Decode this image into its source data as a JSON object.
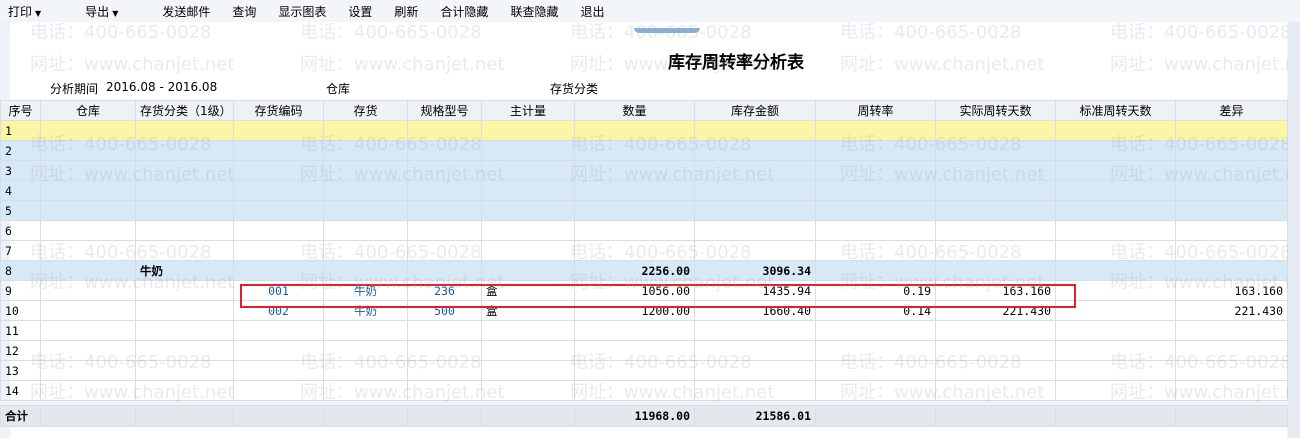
{
  "toolbar": {
    "items": [
      "打印",
      "导出",
      "发送邮件",
      "查询",
      "显示图表",
      "设置",
      "刷新",
      "合计隐藏",
      "联查隐藏",
      "退出"
    ]
  },
  "title": "库存周转率分析表",
  "filters": {
    "period_label": "分析期间",
    "period_value": "2016.08 - 2016.08",
    "warehouse_label": "仓库",
    "category_label": "存货分类"
  },
  "table": {
    "columns": [
      "序号",
      "仓库",
      "存货分类（1级）",
      "存货编码",
      "存货",
      "规格型号",
      "主计量",
      "数量",
      "库存金额",
      "周转率",
      "实际周转天数",
      "标准周转天数",
      "差异"
    ],
    "rows": [
      [
        "1",
        "",
        "",
        "",
        "",
        "",
        "",
        "",
        "",
        "",
        "",
        "",
        ""
      ],
      [
        "2",
        "",
        "",
        "",
        "",
        "",
        "",
        "",
        "",
        "",
        "",
        "",
        ""
      ],
      [
        "3",
        "",
        "",
        "",
        "",
        "",
        "",
        "",
        "",
        "",
        "",
        "",
        ""
      ],
      [
        "4",
        "",
        "",
        "",
        "",
        "",
        "",
        "",
        "",
        "",
        "",
        "",
        ""
      ],
      [
        "5",
        "",
        "",
        "",
        "",
        "",
        "",
        "",
        "",
        "",
        "",
        "",
        ""
      ],
      [
        "6",
        "",
        "",
        "",
        "",
        "",
        "",
        "",
        "",
        "",
        "",
        "",
        ""
      ],
      [
        "7",
        "",
        "",
        "",
        "",
        "",
        "",
        "",
        "",
        "",
        "",
        "",
        ""
      ],
      [
        "8",
        "",
        "牛奶",
        "",
        "",
        "",
        "",
        "2256.00",
        "3096.34",
        "",
        "",
        "",
        ""
      ],
      [
        "9",
        "",
        "",
        "001",
        "牛奶",
        "236",
        "盒",
        "1056.00",
        "1435.94",
        "0.19",
        "163.160",
        "",
        "163.160"
      ],
      [
        "10",
        "",
        "",
        "002",
        "牛奶",
        "500",
        "盒",
        "1200.00",
        "1660.40",
        "0.14",
        "221.430",
        "",
        "221.430"
      ],
      [
        "11",
        "",
        "",
        "",
        "",
        "",
        "",
        "",
        "",
        "",
        "",
        "",
        ""
      ],
      [
        "12",
        "",
        "",
        "",
        "",
        "",
        "",
        "",
        "",
        "",
        "",
        "",
        ""
      ],
      [
        "13",
        "",
        "",
        "",
        "",
        "",
        "",
        "",
        "",
        "",
        "",
        "",
        ""
      ],
      [
        "14",
        "",
        "",
        "",
        "",
        "",
        "",
        "",
        "",
        "",
        "",
        "",
        ""
      ]
    ],
    "total": [
      "合计",
      "",
      "",
      "",
      "",
      "",
      "",
      "11968.00",
      "21586.01",
      "",
      "",
      "",
      ""
    ]
  },
  "watermark": {
    "phone": "电话：400-665-0028",
    "site": "网址：www.chanjet.net"
  },
  "colors": {
    "highlight_box": "#e0202a",
    "yellow_row": "#fbf5a6",
    "blue_row": "#d7e8f7"
  }
}
